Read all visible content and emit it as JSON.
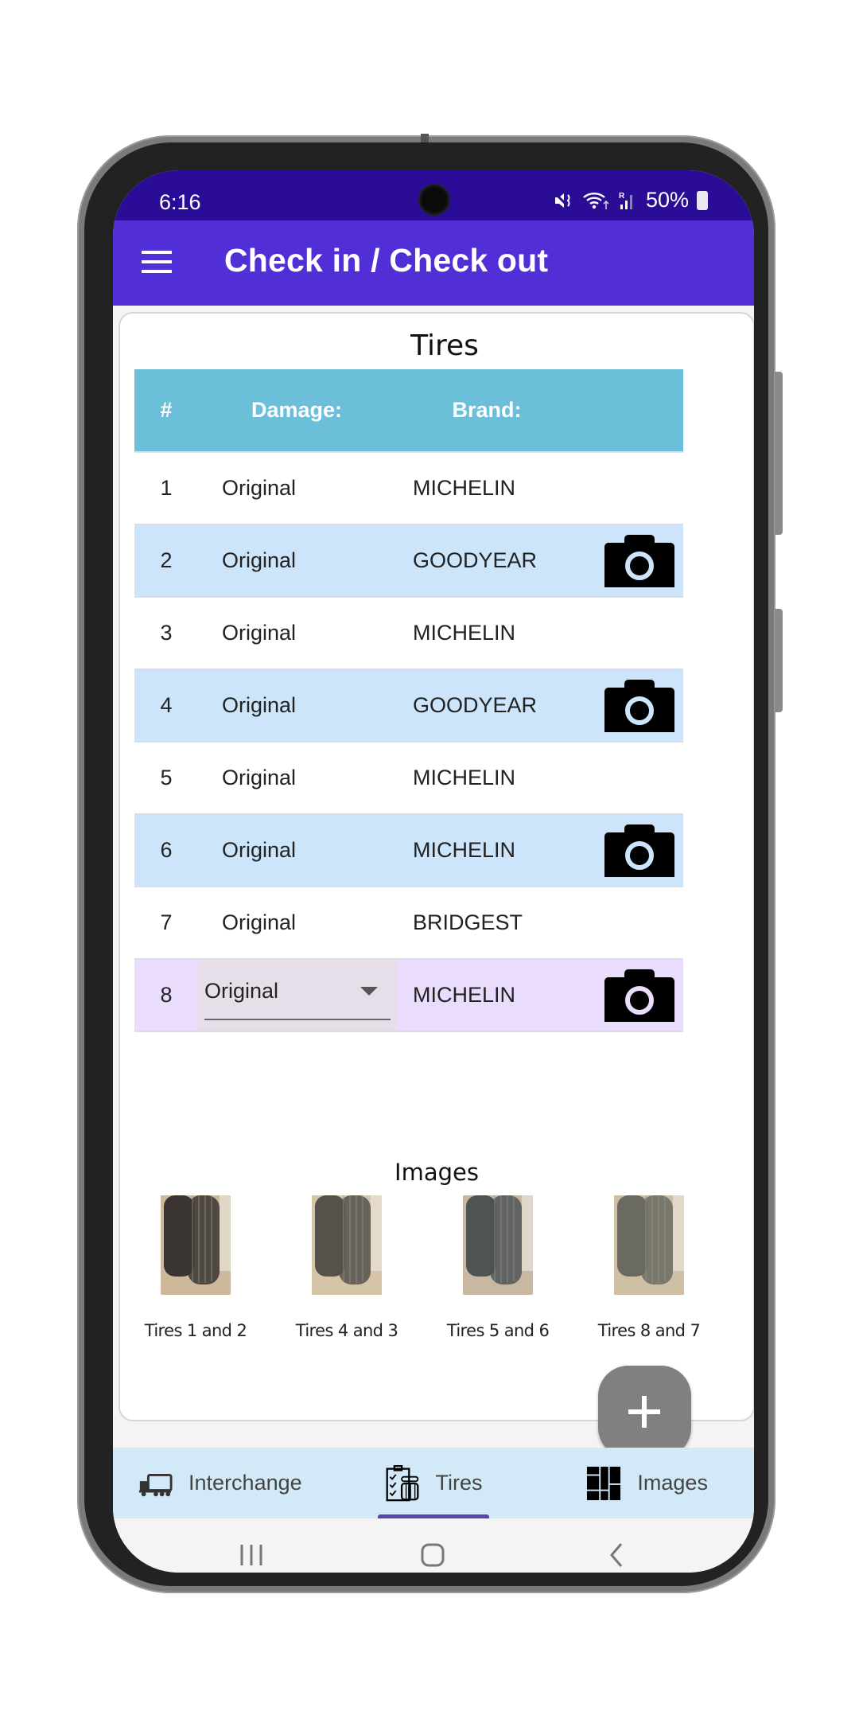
{
  "status_bar": {
    "time": "6:16",
    "battery": "50%",
    "icons": [
      "mute-icon",
      "wifi-icon",
      "signal-roaming-icon",
      "battery-charging-icon"
    ]
  },
  "app_bar": {
    "title": "Check in / Check out",
    "menu_icon": "hamburger-menu-icon"
  },
  "tires": {
    "title": "Tires",
    "columns": [
      "#",
      "Damage:",
      "Brand:"
    ],
    "rows": [
      {
        "num": "1",
        "damage": "Original",
        "brand": "MICHELIN",
        "has_photo": false
      },
      {
        "num": "2",
        "damage": "Original",
        "brand": "GOODYEAR",
        "has_photo": true
      },
      {
        "num": "3",
        "damage": "Original",
        "brand": "MICHELIN",
        "has_photo": false
      },
      {
        "num": "4",
        "damage": "Original",
        "brand": "GOODYEAR",
        "has_photo": true
      },
      {
        "num": "5",
        "damage": "Original",
        "brand": "MICHELIN",
        "has_photo": false
      },
      {
        "num": "6",
        "damage": "Original",
        "brand": "MICHELIN",
        "has_photo": true
      },
      {
        "num": "7",
        "damage": "Original",
        "brand": "BRIDGEST",
        "has_photo": false
      },
      {
        "num": "8",
        "damage": "Original",
        "brand": "MICHELIN",
        "has_photo": true,
        "editing": true
      }
    ]
  },
  "images": {
    "title": "Images",
    "items": [
      {
        "label": "Tires 1 and 2"
      },
      {
        "label": "Tires 4 and 3"
      },
      {
        "label": "Tires 5 and 6"
      },
      {
        "label": "Tires 8 and 7"
      }
    ]
  },
  "fab": {
    "icon": "plus-icon"
  },
  "bottom_nav": {
    "items": [
      {
        "label": "Interchange",
        "icon": "truck-icon",
        "active": false
      },
      {
        "label": "Tires",
        "icon": "tire-checklist-icon",
        "active": true
      },
      {
        "label": "Images",
        "icon": "image-grid-icon",
        "active": false
      }
    ]
  },
  "colors": {
    "status_bar": "#2b0c96",
    "app_bar": "#512ed5",
    "table_header": "#6bbfd9",
    "row_alt": "#cce5fb",
    "row_selected": "#eadcfd",
    "bottom_nav": "#d2e9f7",
    "active_indicator": "#5a44b0",
    "fab": "#808080"
  }
}
